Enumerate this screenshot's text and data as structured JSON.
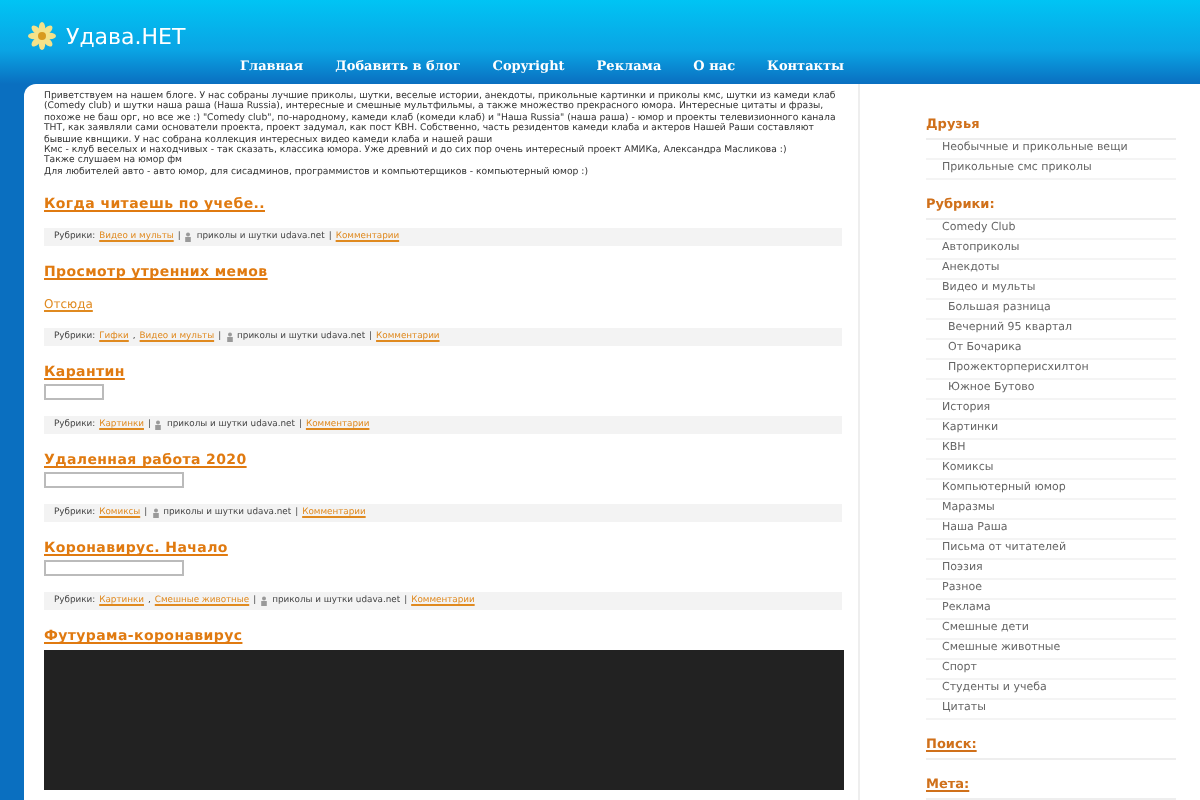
{
  "site": {
    "title": "Удава.НЕТ"
  },
  "nav": [
    "Главная",
    "Добавить в блог",
    "Copyright",
    "Реклама",
    "О нас",
    "Контакты"
  ],
  "intro": [
    "Приветствуем на нашем блоге. У нас собраны лучшие приколы, шутки, веселые истории, анекдоты, прикольные картинки и приколы кмс, шутки из камеди клаб (Comedy club) и шутки наша раша (Наша Russia), интересные и смешные мультфильмы, а также множество прекрасного юмора. Интересные цитаты и фразы, похоже не баш орг, но все же :) \"Comedy club\", по-народному, камеди клаб (комеди клаб) и \"Наша Russia\" (наша раша) - юмор и проекты телевизионного канала ТНТ, как заявляли сами основатели проекта, проект задумал, как пост КВН. Собственно, часть резидентов камеди клаба и актеров Нашей Раши составляют бывшие квнщики. У нас собрана коллекция интересных видео камеди клаба и нашей раши",
    "Кмс - клуб веселых и находчивых - так сказать, классика юмора. Уже древний и до сих пор очень интересный проект АМИКа, Александра Масликова :)",
    "Также слушаем на юмор фм",
    "Для любителей авто - авто юмор, для сисадминов, программистов и компьютерщиков - компьютерный юмор :)"
  ],
  "posts": [
    {
      "title": "Когда читаешь по учебе..",
      "body": {
        "kind": "none"
      },
      "meta": [
        {
          "kind": "text",
          "text": "Рубрики:"
        },
        {
          "kind": "link",
          "text": "Видео и мульты"
        },
        {
          "kind": "text",
          "text": "|"
        },
        {
          "kind": "author",
          "text": "приколы и шутки udava.net"
        },
        {
          "kind": "text",
          "text": "|"
        },
        {
          "kind": "link",
          "text": "Комментарии"
        }
      ]
    },
    {
      "title": "Просмотр утренних мемов",
      "body": {
        "kind": "link",
        "text": "Отсюда"
      },
      "meta": [
        {
          "kind": "text",
          "text": "Рубрики:"
        },
        {
          "kind": "link",
          "text": "Гифки"
        },
        {
          "kind": "text",
          "text": ","
        },
        {
          "kind": "link",
          "text": "Видео и мульты"
        },
        {
          "kind": "text",
          "text": "|"
        },
        {
          "kind": "author",
          "text": "приколы и шутки udava.net"
        },
        {
          "kind": "text",
          "text": "|"
        },
        {
          "kind": "link",
          "text": "Комментарии"
        }
      ]
    },
    {
      "title": "Карантин",
      "body": {
        "kind": "box"
      },
      "meta": [
        {
          "kind": "text",
          "text": "Рубрики:"
        },
        {
          "kind": "link",
          "text": "Картинки"
        },
        {
          "kind": "text",
          "text": "|"
        },
        {
          "kind": "author",
          "text": "приколы и шутки udava.net"
        },
        {
          "kind": "text",
          "text": "|"
        },
        {
          "kind": "link",
          "text": "Комментарии"
        }
      ]
    },
    {
      "title": "Удаленная работа 2020",
      "body": {
        "kind": "widebox"
      },
      "meta": [
        {
          "kind": "text",
          "text": "Рубрики:"
        },
        {
          "kind": "link",
          "text": "Комиксы"
        },
        {
          "kind": "text",
          "text": "|"
        },
        {
          "kind": "author",
          "text": "приколы и шутки udava.net"
        },
        {
          "kind": "text",
          "text": "|"
        },
        {
          "kind": "link",
          "text": "Комментарии"
        }
      ]
    },
    {
      "title": "Коронавирус. Начало",
      "body": {
        "kind": "widebox"
      },
      "meta": [
        {
          "kind": "text",
          "text": "Рубрики:"
        },
        {
          "kind": "link",
          "text": "Картинки"
        },
        {
          "kind": "text",
          "text": ","
        },
        {
          "kind": "link",
          "text": "Смешные животные"
        },
        {
          "kind": "text",
          "text": "|"
        },
        {
          "kind": "author",
          "text": "приколы и шутки udava.net"
        },
        {
          "kind": "text",
          "text": "|"
        },
        {
          "kind": "link",
          "text": "Комментарии"
        }
      ]
    },
    {
      "title": "Футурама-коронавирус",
      "body": {
        "kind": "video"
      }
    }
  ],
  "sidebar": {
    "friends": {
      "title": "Друзья",
      "items": [
        "Необычные и прикольные вещи",
        "Прикольные смс приколы"
      ]
    },
    "categories": {
      "title": "Рубрики:",
      "items": [
        {
          "label": "Comedy Club"
        },
        {
          "label": "Автоприколы"
        },
        {
          "label": "Анекдоты"
        },
        {
          "label": "Видео и мульты",
          "children": [
            {
              "label": "Большая разница"
            },
            {
              "label": "Вечерний 95 квартал"
            },
            {
              "label": "От Бочарика"
            },
            {
              "label": "Прожекторперисхилтон"
            },
            {
              "label": "Южное Бутово"
            }
          ]
        },
        {
          "label": "История"
        },
        {
          "label": "Картинки"
        },
        {
          "label": "КВН"
        },
        {
          "label": "Комиксы"
        },
        {
          "label": "Компьютерный юмор"
        },
        {
          "label": "Маразмы"
        },
        {
          "label": "Наша Раша"
        },
        {
          "label": "Письма от читателей"
        },
        {
          "label": "Поэзия"
        },
        {
          "label": "Разное"
        },
        {
          "label": "Реклама"
        },
        {
          "label": "Смешные дети"
        },
        {
          "label": "Смешные животные"
        },
        {
          "label": "Спорт"
        },
        {
          "label": "Студенты и учеба"
        },
        {
          "label": "Цитаты"
        }
      ]
    },
    "search": {
      "title": "Поиск:"
    },
    "meta": {
      "title": "Мета:"
    }
  }
}
